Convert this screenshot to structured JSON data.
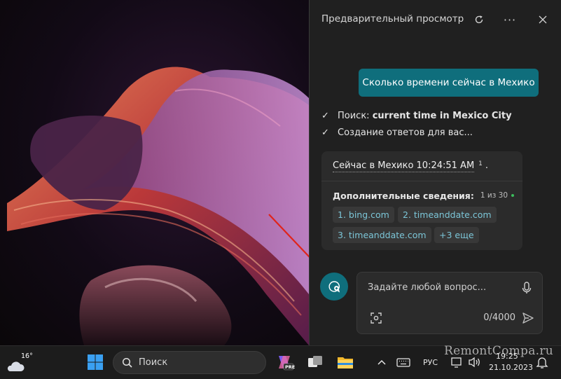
{
  "pane": {
    "title": "Предварительный просмотр",
    "user_message": "Сколько времени сейчас в Мехико",
    "steps": [
      {
        "prefix": "Поиск: ",
        "bold": "current time in Mexico City"
      },
      {
        "prefix": "Создание ответов для вас...",
        "bold": ""
      }
    ],
    "answer": {
      "text": "Сейчас в Мехико 10:24:51 AM",
      "citation": "1",
      "trailing": ".",
      "more_label": "Дополнительные сведения:",
      "page_count": "1 из 30",
      "sources": [
        "1. bing.com",
        "2. timeanddate.com",
        "3. timeanddate.com",
        "+3 еще"
      ]
    },
    "input": {
      "placeholder": "Задайте любой вопрос...",
      "char_count": "0/4000"
    }
  },
  "taskbar": {
    "temperature": "16°",
    "search_placeholder": "Поиск",
    "language": "РУС",
    "time": "19:25",
    "date": "21.10.2023",
    "copilot_badge": "PRE"
  },
  "watermark": "RemontCompa.ru",
  "colors": {
    "accent": "#0f6e7c",
    "pane_bg": "#202020",
    "card_bg": "#2b2b2b",
    "link": "#7cc6d8",
    "arrow": "#e0241b"
  }
}
